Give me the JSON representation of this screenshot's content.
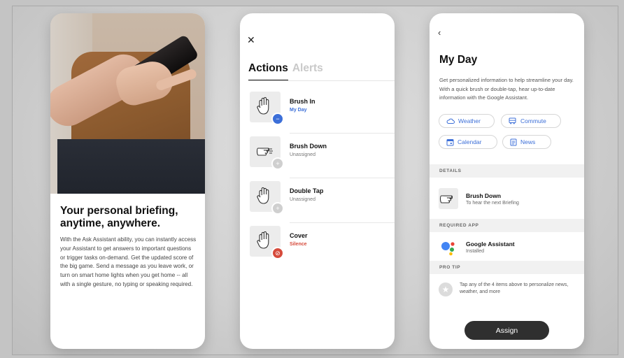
{
  "colors": {
    "accent_blue": "#3c6fd8",
    "alert_red": "#d64b3c",
    "button_dark": "#2f2f2f",
    "section_gray": "#f1f1f1"
  },
  "screen1": {
    "title": "Your personal briefing, anytime, anywhere.",
    "body": "With the Ask Assistant ability, you can instantly access your Assistant to get answers to important questions or trigger tasks on-demand. Get the updated score of the big game. Send a message as you leave work, or turn on smart home lights when you get home -- all with a single gesture, no typing or speaking required."
  },
  "screen2": {
    "close_icon": "close-icon",
    "tabs": [
      {
        "label": "Actions",
        "active": true
      },
      {
        "label": "Alerts",
        "active": false
      }
    ],
    "actions": [
      {
        "title": "Brush In",
        "subtitle": "My Day",
        "status": "assigned",
        "badge_icon": "minus-icon",
        "badge_color": "#3c6fd8"
      },
      {
        "title": "Brush Down",
        "subtitle": "Unassigned",
        "status": "unassigned",
        "badge_icon": "plus-icon",
        "badge_color": "#cfcfcf"
      },
      {
        "title": "Double Tap",
        "subtitle": "Unassigned",
        "status": "unassigned",
        "badge_icon": "plus-icon",
        "badge_color": "#cfcfcf"
      },
      {
        "title": "Cover",
        "subtitle": "Silence",
        "status": "alert",
        "badge_icon": "block-icon",
        "badge_color": "#d64b3c"
      }
    ]
  },
  "screen3": {
    "back_icon": "chevron-left-icon",
    "title": "My Day",
    "description": "Get personalized information to help streamline your day. With a quick brush or double-tap, hear up-to-date information with the Google Assistant.",
    "chips": [
      {
        "label": "Weather",
        "icon": "cloud-icon"
      },
      {
        "label": "Commute",
        "icon": "bus-icon"
      },
      {
        "label": "Calendar",
        "icon": "calendar-icon"
      },
      {
        "label": "News",
        "icon": "news-icon"
      }
    ],
    "details_header": "DETAILS",
    "detail_title": "Brush Down",
    "detail_subtitle": "To hear the next Briefing",
    "required_header": "REQUIRED APP",
    "app_name": "Google Assistant",
    "app_status": "Installed",
    "tip_header": "PRO TIP",
    "tip_text": "Tap any of the 4 items above to personalize news, weather, and more",
    "assign_label": "Assign"
  }
}
